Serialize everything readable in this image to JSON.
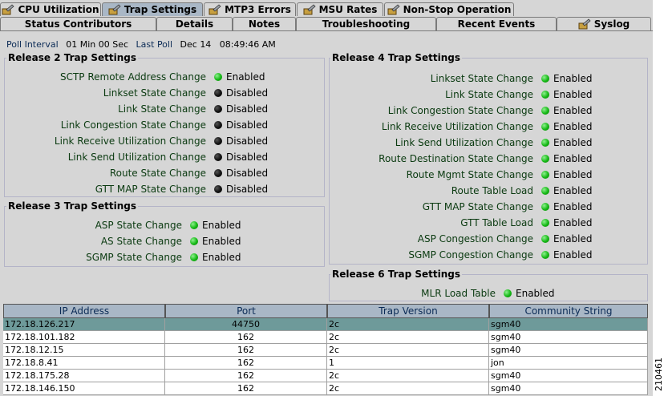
{
  "tabs_row1": [
    {
      "label": "CPU Utilization",
      "icon": "tool-icon",
      "active": false
    },
    {
      "label": "Trap Settings",
      "icon": "tool-icon",
      "active": true
    },
    {
      "label": "MTP3 Errors",
      "icon": "tool-icon",
      "active": false
    },
    {
      "label": "MSU Rates",
      "icon": "tool-icon",
      "active": false
    },
    {
      "label": "Non-Stop Operation",
      "icon": "tool-icon",
      "active": false
    }
  ],
  "tabs_row2": [
    {
      "label": "Status Contributors",
      "icon": ""
    },
    {
      "label": "Details",
      "icon": ""
    },
    {
      "label": "Notes",
      "icon": ""
    },
    {
      "label": "Troubleshooting",
      "icon": ""
    },
    {
      "label": "Recent Events",
      "icon": ""
    },
    {
      "label": "Syslog",
      "icon": "tool-icon"
    }
  ],
  "poll": {
    "interval_label": "Poll Interval",
    "interval_value": "01 Min 00 Sec",
    "last_label": "Last Poll",
    "last_value": "Dec 14   08:49:46 AM"
  },
  "release2": {
    "title": "Release 2 Trap Settings",
    "items": [
      {
        "label": "SCTP Remote Address Change",
        "value": "Enabled",
        "status": "on"
      },
      {
        "label": "Linkset State Change",
        "value": "Disabled",
        "status": "off"
      },
      {
        "label": "Link State Change",
        "value": "Disabled",
        "status": "off"
      },
      {
        "label": "Link Congestion State Change",
        "value": "Disabled",
        "status": "off"
      },
      {
        "label": "Link Receive Utilization Change",
        "value": "Disabled",
        "status": "off"
      },
      {
        "label": "Link Send Utilization Change",
        "value": "Disabled",
        "status": "off"
      },
      {
        "label": "Route State Change",
        "value": "Disabled",
        "status": "off"
      },
      {
        "label": "GTT MAP State Change",
        "value": "Disabled",
        "status": "off"
      }
    ]
  },
  "release3": {
    "title": "Release 3 Trap Settings",
    "items": [
      {
        "label": "ASP State Change",
        "value": "Enabled",
        "status": "on"
      },
      {
        "label": "AS State Change",
        "value": "Enabled",
        "status": "on"
      },
      {
        "label": "SGMP State Change",
        "value": "Enabled",
        "status": "on"
      }
    ]
  },
  "release4": {
    "title": "Release 4 Trap Settings",
    "items": [
      {
        "label": "Linkset State Change",
        "value": "Enabled",
        "status": "on"
      },
      {
        "label": "Link State Change",
        "value": "Enabled",
        "status": "on"
      },
      {
        "label": "Link Congestion State Change",
        "value": "Enabled",
        "status": "on"
      },
      {
        "label": "Link Receive Utilization Change",
        "value": "Enabled",
        "status": "on"
      },
      {
        "label": "Link Send Utilization Change",
        "value": "Enabled",
        "status": "on"
      },
      {
        "label": "Route Destination State Change",
        "value": "Enabled",
        "status": "on"
      },
      {
        "label": "Route Mgmt State Change",
        "value": "Enabled",
        "status": "on"
      },
      {
        "label": "Route Table Load",
        "value": "Enabled",
        "status": "on"
      },
      {
        "label": "GTT MAP State Change",
        "value": "Enabled",
        "status": "on"
      },
      {
        "label": "GTT Table Load",
        "value": "Enabled",
        "status": "on"
      },
      {
        "label": "ASP Congestion Change",
        "value": "Enabled",
        "status": "on"
      },
      {
        "label": "SGMP Congestion Change",
        "value": "Enabled",
        "status": "on"
      }
    ]
  },
  "release6": {
    "title": "Release 6 Trap Settings",
    "items": [
      {
        "label": "MLR Load Table",
        "value": "Enabled",
        "status": "on"
      }
    ]
  },
  "table": {
    "columns": [
      "IP Address",
      "Port",
      "Trap Version",
      "Community String"
    ],
    "rows": [
      [
        "172.18.126.217",
        "44750",
        "2c",
        "sgm40"
      ],
      [
        "172.18.101.182",
        "162",
        "2c",
        "sgm40"
      ],
      [
        "172.18.12.15",
        "162",
        "2c",
        "sgm40"
      ],
      [
        "172.18.8.41",
        "162",
        "1",
        "jon"
      ],
      [
        "172.18.175.28",
        "162",
        "2c",
        "sgm40"
      ],
      [
        "172.18.146.150",
        "162",
        "2c",
        "sgm40"
      ]
    ],
    "selected_row": 0
  },
  "figure_id": "210461",
  "colors": {
    "accent": "#a9b7c6",
    "selected_row": "#6e9a9a",
    "enabled": "#14b814",
    "disabled": "#000000"
  }
}
